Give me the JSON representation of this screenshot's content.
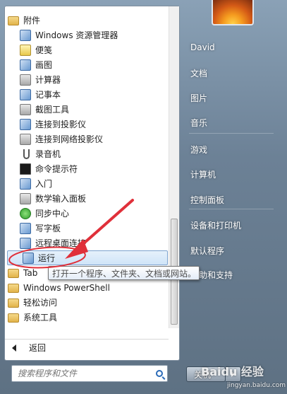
{
  "programs": [
    {
      "label": "附件",
      "icon": "folder-icon",
      "kind": "folder"
    },
    {
      "label": "Windows 资源管理器",
      "icon": "explorer-icon",
      "kind": "sub"
    },
    {
      "label": "便笺",
      "icon": "sticky-notes-icon",
      "kind": "sub"
    },
    {
      "label": "画图",
      "icon": "paint-icon",
      "kind": "sub"
    },
    {
      "label": "计算器",
      "icon": "calculator-icon",
      "kind": "sub"
    },
    {
      "label": "记事本",
      "icon": "notepad-icon",
      "kind": "sub"
    },
    {
      "label": "截图工具",
      "icon": "snipping-tool-icon",
      "kind": "sub"
    },
    {
      "label": "连接到投影仪",
      "icon": "projector-icon",
      "kind": "sub"
    },
    {
      "label": "连接到网络投影仪",
      "icon": "network-projector-icon",
      "kind": "sub"
    },
    {
      "label": "录音机",
      "icon": "sound-recorder-icon",
      "kind": "sub"
    },
    {
      "label": "命令提示符",
      "icon": "command-prompt-icon",
      "kind": "sub"
    },
    {
      "label": "入门",
      "icon": "getting-started-icon",
      "kind": "sub"
    },
    {
      "label": "数学输入面板",
      "icon": "math-input-icon",
      "kind": "sub"
    },
    {
      "label": "同步中心",
      "icon": "sync-center-icon",
      "kind": "sub"
    },
    {
      "label": "写字板",
      "icon": "wordpad-icon",
      "kind": "sub"
    },
    {
      "label": "远程桌面连接",
      "icon": "remote-desktop-icon",
      "kind": "sub"
    },
    {
      "label": "运行",
      "icon": "run-icon",
      "kind": "sub",
      "highlighted": true
    },
    {
      "label": "Tab",
      "icon": "folder-icon",
      "kind": "folder"
    },
    {
      "label": "Windows PowerShell",
      "icon": "folder-icon",
      "kind": "folder"
    },
    {
      "label": "轻松访问",
      "icon": "folder-icon",
      "kind": "folder"
    },
    {
      "label": "系统工具",
      "icon": "folder-icon",
      "kind": "folder"
    }
  ],
  "back_label": "返回",
  "search": {
    "placeholder": "搜索程序和文件"
  },
  "right_links": [
    "David",
    "文档",
    "图片",
    "音乐",
    "游戏",
    "计算机",
    "控制面板",
    "设备和打印机",
    "默认程序",
    "帮助和支持"
  ],
  "tooltip": "打开一个程序、文件夹、文档或网站。",
  "shutdown_label": "关机",
  "watermark": {
    "main": "Baidu 经验",
    "sub": "jingyan.baidu.com"
  },
  "colors": {
    "annotation": "#e0303a",
    "accent": "#2b6bb8"
  }
}
